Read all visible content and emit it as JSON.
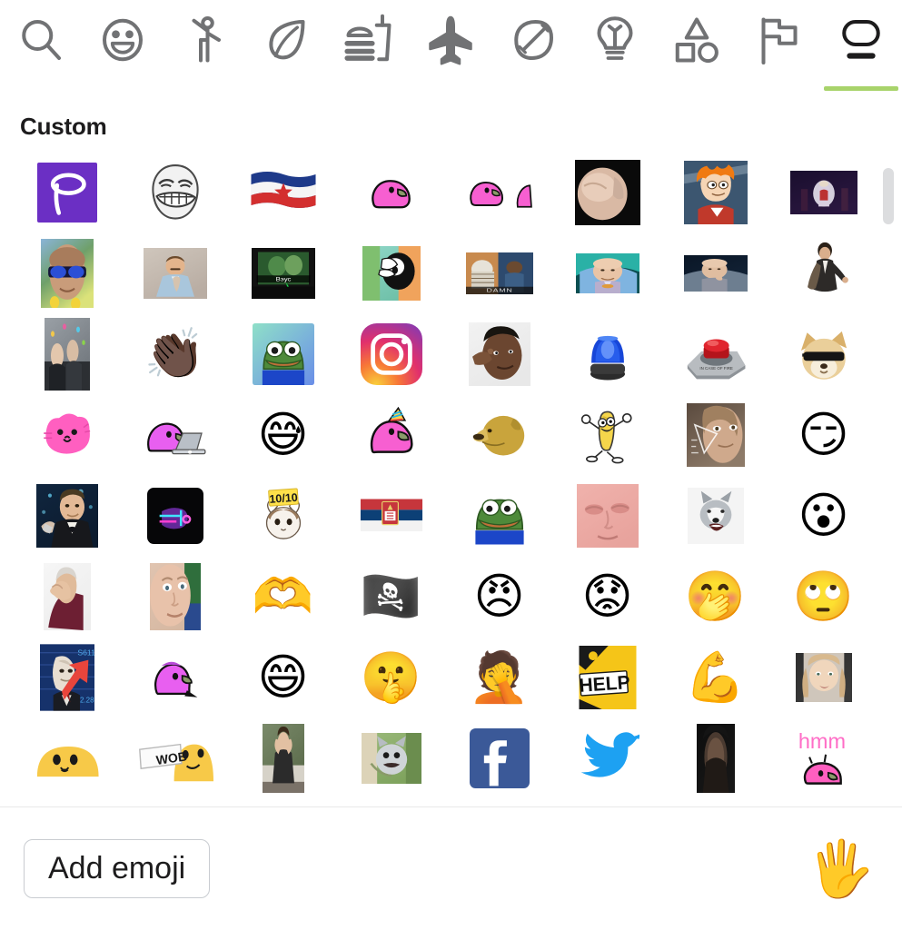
{
  "picker": {
    "title": "Custom",
    "tabs": [
      {
        "name": "search",
        "icon": "search-icon",
        "label": "Search",
        "active": false
      },
      {
        "name": "smileys",
        "icon": "smiley-icon",
        "label": "Smileys & Emotion",
        "active": false
      },
      {
        "name": "people",
        "icon": "person-icon",
        "label": "People & Body",
        "active": false
      },
      {
        "name": "nature",
        "icon": "leaf-icon",
        "label": "Animals & Nature",
        "active": false
      },
      {
        "name": "food",
        "icon": "food-drink-icon",
        "label": "Food & Drink",
        "active": false
      },
      {
        "name": "travel",
        "icon": "airplane-icon",
        "label": "Travel & Places",
        "active": false
      },
      {
        "name": "activities",
        "icon": "football-icon",
        "label": "Activities",
        "active": false
      },
      {
        "name": "objects",
        "icon": "lightbulb-icon",
        "label": "Objects",
        "active": false
      },
      {
        "name": "symbols",
        "icon": "shapes-icon",
        "label": "Symbols",
        "active": false
      },
      {
        "name": "flags",
        "icon": "flag-icon",
        "label": "Flags",
        "active": false
      },
      {
        "name": "custom",
        "icon": "custom-emoji-icon",
        "label": "Custom",
        "active": true
      }
    ],
    "accent_color": "#a8d36b",
    "icon_color": "#717274",
    "icon_color_active": "#1d1c1d",
    "scrollbar_color": "#dcdddf"
  },
  "footer": {
    "add_emoji_label": "Add emoji",
    "skin_tone_icon": "raised-hand-icon",
    "skin_tone_glyph": "🖐"
  },
  "grid": {
    "columns": 8,
    "rows": [
      [
        {
          "name": "emoji-pitch-logo",
          "kind": "img",
          "render": "pitch-logo"
        },
        {
          "name": "emoji-troll-face",
          "kind": "img",
          "render": "trollface"
        },
        {
          "name": "emoji-flag-yugoslavia",
          "kind": "img",
          "render": "flag-yugoslavia"
        },
        {
          "name": "emoji-party-parrot",
          "kind": "img",
          "render": "parrot-plain"
        },
        {
          "name": "emoji-parrot-pair",
          "kind": "img",
          "render": "parrot-pair"
        },
        {
          "name": "emoji-cat-paw-photo",
          "kind": "img",
          "render": "photo-paw"
        },
        {
          "name": "emoji-futurama-fry",
          "kind": "img",
          "render": "fry"
        },
        {
          "name": "emoji-stage-scene",
          "kind": "img",
          "render": "photo-stage"
        }
      ],
      [
        {
          "name": "emoji-sunglasses-man",
          "kind": "img",
          "render": "photo-sunglasses"
        },
        {
          "name": "emoji-ron-burgundy",
          "kind": "img",
          "render": "photo-burgundy"
        },
        {
          "name": "emoji-tv-russian",
          "kind": "img",
          "render": "photo-tv"
        },
        {
          "name": "emoji-goofy",
          "kind": "img",
          "render": "photo-goofy"
        },
        {
          "name": "emoji-friday-movie",
          "kind": "img",
          "render": "photo-friday"
        },
        {
          "name": "emoji-dr-evil-one",
          "kind": "img",
          "render": "photo-drevil1"
        },
        {
          "name": "emoji-dr-evil-two",
          "kind": "img",
          "render": "photo-drevil2"
        },
        {
          "name": "emoji-travolta",
          "kind": "img",
          "render": "photo-travolta"
        }
      ],
      [
        {
          "name": "emoji-crowd-photo",
          "kind": "img",
          "render": "photo-crowd"
        },
        {
          "name": "emoji-clapping-hands",
          "kind": "uni",
          "glyph": "👏🏿"
        },
        {
          "name": "emoji-pepe-frog",
          "kind": "img",
          "render": "pepe-square"
        },
        {
          "name": "emoji-instagram-logo",
          "kind": "img",
          "render": "instagram"
        },
        {
          "name": "emoji-roll-safe",
          "kind": "img",
          "render": "photo-rollsafe"
        },
        {
          "name": "emoji-blue-siren",
          "kind": "img",
          "render": "siren-blue"
        },
        {
          "name": "emoji-red-button",
          "kind": "img",
          "render": "red-button"
        },
        {
          "name": "emoji-doge-sunglasses",
          "kind": "img",
          "render": "doge-shades"
        }
      ],
      [
        {
          "name": "emoji-pink-cat",
          "kind": "img",
          "render": "pink-cat"
        },
        {
          "name": "emoji-parrot-laptop",
          "kind": "img",
          "render": "parrot-laptop"
        },
        {
          "name": "emoji-sweat-smile",
          "kind": "uni",
          "glyph": "😅"
        },
        {
          "name": "emoji-party-parrot-hat",
          "kind": "img",
          "render": "parrot-party"
        },
        {
          "name": "emoji-doge-head",
          "kind": "img",
          "render": "doge-head"
        },
        {
          "name": "emoji-banana-dance",
          "kind": "img",
          "render": "banana"
        },
        {
          "name": "emoji-math-lady",
          "kind": "img",
          "render": "photo-mathlady"
        },
        {
          "name": "emoji-side-eye",
          "kind": "uni",
          "glyph": "😏"
        }
      ],
      [
        {
          "name": "emoji-leo-cheers",
          "kind": "img",
          "render": "photo-leo"
        },
        {
          "name": "emoji-neon-dark",
          "kind": "img",
          "render": "neon-dark"
        },
        {
          "name": "emoji-ten-out-of-ten",
          "kind": "img",
          "render": "cat-ten"
        },
        {
          "name": "emoji-flag-serbia",
          "kind": "img",
          "render": "flag-serbia"
        },
        {
          "name": "emoji-sad-pepe",
          "kind": "img",
          "render": "pepe-sad"
        },
        {
          "name": "emoji-pink-face-photo",
          "kind": "img",
          "render": "photo-pinkface"
        },
        {
          "name": "emoji-husky-dog",
          "kind": "img",
          "render": "husky"
        },
        {
          "name": "emoji-astonished-face",
          "kind": "uni",
          "glyph": "😮"
        }
      ],
      [
        {
          "name": "emoji-picard-facepalm",
          "kind": "img",
          "render": "photo-picard"
        },
        {
          "name": "emoji-staring-man",
          "kind": "img",
          "render": "photo-staring"
        },
        {
          "name": "emoji-heart-hands",
          "kind": "uni",
          "glyph": "🫶"
        },
        {
          "name": "emoji-pirate-face",
          "kind": "uni",
          "glyph": "🏴‍☠️"
        },
        {
          "name": "emoji-angry-face",
          "kind": "uni",
          "glyph": "😠"
        },
        {
          "name": "emoji-worried-face",
          "kind": "uni",
          "glyph": "😟"
        },
        {
          "name": "emoji-hand-over-mouth",
          "kind": "uni",
          "glyph": "🤭"
        },
        {
          "name": "emoji-rolling-eyes",
          "kind": "uni",
          "glyph": "🙄"
        }
      ],
      [
        {
          "name": "emoji-stonks",
          "kind": "img",
          "render": "stonks"
        },
        {
          "name": "emoji-parrot-bounce",
          "kind": "img",
          "render": "parrot-bounce"
        },
        {
          "name": "emoji-smiling-closed-eyes",
          "kind": "uni",
          "glyph": "😄"
        },
        {
          "name": "emoji-shushing-face",
          "kind": "uni",
          "glyph": "🤫"
        },
        {
          "name": "emoji-facepalm-emoji",
          "kind": "uni",
          "glyph": "🤦"
        },
        {
          "name": "emoji-help-sign",
          "kind": "img",
          "render": "help-sign"
        },
        {
          "name": "emoji-flexed-biceps",
          "kind": "uni",
          "glyph": "💪"
        },
        {
          "name": "emoji-blonde-girl",
          "kind": "img",
          "render": "photo-girl"
        }
      ],
      [
        {
          "name": "emoji-peeking-face",
          "kind": "img",
          "render": "peek-face"
        },
        {
          "name": "emoji-wob-sign",
          "kind": "img",
          "render": "wob-sign"
        },
        {
          "name": "emoji-person-photo",
          "kind": "img",
          "render": "photo-person"
        },
        {
          "name": "emoji-cat-meme",
          "kind": "img",
          "render": "photo-catmeme"
        },
        {
          "name": "emoji-facebook-logo",
          "kind": "img",
          "render": "facebook"
        },
        {
          "name": "emoji-twitter-bird",
          "kind": "img",
          "render": "twitter"
        },
        {
          "name": "emoji-dark-photo",
          "kind": "img",
          "render": "photo-dark"
        },
        {
          "name": "emoji-hmm-parrot",
          "kind": "img",
          "render": "hmm-parrot"
        }
      ]
    ]
  }
}
